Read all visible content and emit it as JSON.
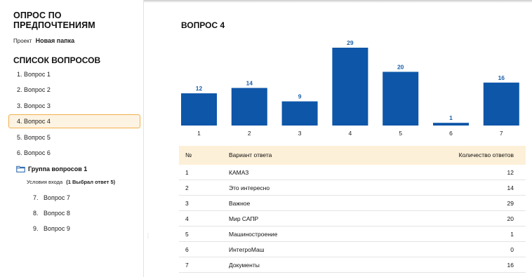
{
  "sidebar": {
    "title": "ОПРОС ПО ПРЕДПОЧТЕНИЯМ",
    "project_label": "Проект",
    "project_name": "Новая папка",
    "questions_title": "СПИСОК ВОПРОСОВ",
    "questions": [
      {
        "label": "1. Вопрос 1"
      },
      {
        "label": "2. Вопрос 2"
      },
      {
        "label": "3. Вопрос 3"
      },
      {
        "label": "4. Вопрос 4"
      },
      {
        "label": "5. Вопрос 5"
      },
      {
        "label": "6. Вопрос 6"
      }
    ],
    "active_index": 3,
    "group": {
      "label": "Группа вопросов 1",
      "icon": "folder-icon",
      "condition_label": "Условия входа",
      "condition_value": "(1 Выбрал ответ 5)",
      "items": [
        {
          "label": "7.   Вопрос 7"
        },
        {
          "label": "8.   Вопрос 8"
        },
        {
          "label": "9.   Вопрос 9"
        }
      ]
    }
  },
  "main": {
    "title": "ВОПРОС 4"
  },
  "colors": {
    "bar": "#0e56a8",
    "label": "#1a5ea8",
    "active_bg": "#fdf3e3",
    "active_border": "#f0b04a",
    "table_header": "#fdf0d8"
  },
  "chart_data": {
    "type": "bar",
    "categories": [
      "1",
      "2",
      "3",
      "4",
      "5",
      "6",
      "7"
    ],
    "values": [
      12,
      14,
      9,
      29,
      20,
      1,
      16
    ],
    "title": "",
    "xlabel": "",
    "ylabel": "",
    "ylim": [
      0,
      29
    ],
    "grid": false
  },
  "table": {
    "headers": [
      "№",
      "Вариант ответа",
      "Количество ответов"
    ],
    "rows": [
      [
        "1",
        "КАМАЗ",
        "12"
      ],
      [
        "2",
        "Это интересно",
        "14"
      ],
      [
        "3",
        "Важное",
        "29"
      ],
      [
        "4",
        "Мир САПР",
        "20"
      ],
      [
        "5",
        "Машиностроение",
        "1"
      ],
      [
        "6",
        "ИнтегроМаш",
        "0"
      ],
      [
        "7",
        "Документы",
        "16"
      ]
    ]
  }
}
